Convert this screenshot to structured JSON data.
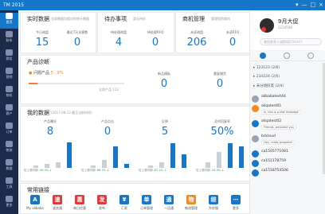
{
  "window": {
    "title": "TM 2015",
    "controls": [
      "▾",
      "—",
      "□",
      "×"
    ]
  },
  "sidebar": {
    "items": [
      {
        "label": "首页",
        "icon": "home-icon"
      },
      {
        "label": "联系",
        "icon": "contacts-icon"
      },
      {
        "label": "群组",
        "icon": "group-icon"
      },
      {
        "label": "营销",
        "icon": "marketing-icon"
      },
      {
        "label": "商机",
        "icon": "business-icon"
      },
      {
        "label": "客户",
        "icon": "customer-icon"
      },
      {
        "label": "订单",
        "icon": "order-icon"
      },
      {
        "label": "物流",
        "icon": "logistics-icon"
      },
      {
        "label": "数据",
        "icon": "data-icon"
      },
      {
        "label": "工具",
        "icon": "tools-icon"
      },
      {
        "label": "更多",
        "icon": "more-icon"
      }
    ]
  },
  "realtime": {
    "title": "实时数据",
    "sub": "全部数据均相对的统计数据",
    "kpis": [
      {
        "label": "今日询盘",
        "value": "15"
      },
      {
        "label": "最近7天访客数",
        "value": "0"
      }
    ]
  },
  "todo": {
    "title": "待办事项",
    "sub": "暂无待办",
    "kpis": [
      {
        "label": "待处理询盘",
        "value": "4"
      },
      {
        "label": "待处理RFQ",
        "value": "0"
      }
    ]
  },
  "oppty": {
    "title": "商机管理",
    "sub": "管理您的商机",
    "kpis": [
      {
        "label": "未读询盘",
        "value": "206"
      },
      {
        "label": "未读RFQ",
        "value": "0"
      }
    ]
  },
  "diagnosis": {
    "title": "产品诊断",
    "issue_label": "问题产品",
    "issue_count": "5",
    "issue_pct": "9%",
    "progress_pct": 0.09,
    "total": "全部产品 123",
    "cols": [
      {
        "label": "新品模板",
        "value": "0"
      },
      {
        "label": "重复铺货",
        "value": "0"
      }
    ]
  },
  "mybiz": {
    "title": "我的数据",
    "sub": "(2017-08-13 截至当前时间)",
    "cols": [
      {
        "label": "产品曝光",
        "value": "8",
        "foot_prefix": "较上周同期",
        "pct": "-50.0%",
        "bars": [
          0.1,
          0.15,
          0.2,
          0.95
        ]
      },
      {
        "label": "产品点击",
        "value": "0",
        "foot_prefix": "较上周同期",
        "pct": "-66.7%",
        "bars": [
          0.1,
          0.3,
          0.8,
          0.15
        ]
      },
      {
        "label": "反馈",
        "value": "5",
        "foot_prefix": "较上周同期",
        "pct": "-87.2%",
        "bars": [
          0.1,
          0.2,
          0.9,
          0.5
        ]
      },
      {
        "label": "及时回复率",
        "value": "50%",
        "foot_prefix": "较上周同期",
        "pct": "-14.3%",
        "bars": [
          0.2,
          0.6,
          0.9,
          0.8
        ]
      }
    ]
  },
  "links": {
    "title": "常用链接",
    "items": [
      {
        "label": "My alibaba",
        "glyph": "A",
        "color": "#1677c8"
      },
      {
        "label": "速卖通",
        "glyph": "速",
        "color": "#e4393c"
      },
      {
        "label": "每日优惠",
        "glyph": "惠",
        "color": "#e4393c"
      },
      {
        "label": "发布",
        "glyph": "发",
        "color": "#e4393c"
      },
      {
        "label": "汇款",
        "glyph": "¥",
        "color": "#1677c8"
      },
      {
        "label": "订单管理",
        "glyph": "单",
        "color": "#1677c8"
      },
      {
        "label": "一达通",
        "glyph": "通",
        "color": "#1677c8"
      },
      {
        "label": "物流管理",
        "glyph": "物",
        "color": "#f28a1f"
      },
      {
        "label": "外综服",
        "glyph": "综",
        "color": "#1677c8"
      },
      {
        "label": "更多",
        "glyph": "⋯",
        "color": "#1677c8"
      }
    ]
  },
  "profile": {
    "name": "9月大促",
    "id": "1234568",
    "search_placeholder": "查找联系人或群组(Ctrl+F)"
  },
  "contacts": {
    "groups": [
      "123123 (2/6)",
      "234224 (2/6)",
      "未分组好友 (2/4)"
    ],
    "items": [
      {
        "name": "alibabatest44",
        "msg": "",
        "avatar": "gray"
      },
      {
        "name": "aliqatest01",
        "msg": "hi, this is a test message",
        "avatar": "orange"
      },
      {
        "name": "aliqatest02",
        "msg": "Friends, welcome you",
        "avatar": "blue"
      },
      {
        "name": "bdcloud",
        "msg": "Hey, make progress!",
        "avatar": "gray"
      },
      {
        "name": "ca1505771081",
        "msg": "",
        "avatar": "blue"
      },
      {
        "name": "ca151178759",
        "msg": "",
        "avatar": "blue"
      },
      {
        "name": "ca1518754506",
        "msg": "",
        "avatar": "blue"
      }
    ]
  }
}
